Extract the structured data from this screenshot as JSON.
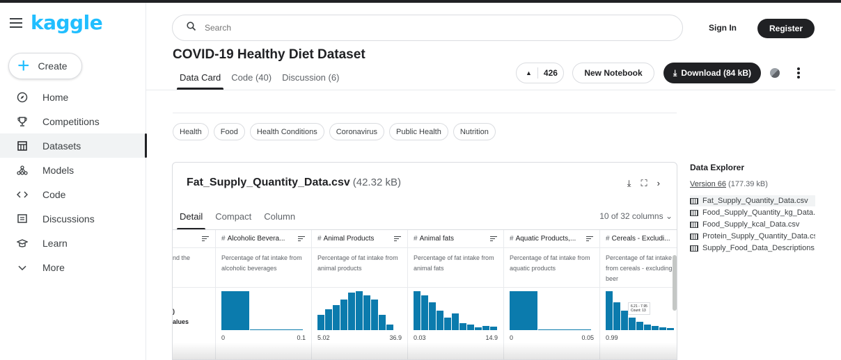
{
  "nav": {
    "logo": "kaggle",
    "create_label": "Create",
    "items": [
      {
        "label": "Home",
        "icon": "compass-icon"
      },
      {
        "label": "Competitions",
        "icon": "trophy-icon"
      },
      {
        "label": "Datasets",
        "icon": "table-icon",
        "active": true
      },
      {
        "label": "Models",
        "icon": "models-icon"
      },
      {
        "label": "Code",
        "icon": "code-icon"
      },
      {
        "label": "Discussions",
        "icon": "comment-icon"
      },
      {
        "label": "Learn",
        "icon": "graduation-cap-icon"
      },
      {
        "label": "More",
        "icon": "chevron-down-icon"
      }
    ]
  },
  "header": {
    "search_placeholder": "Search",
    "sign_in": "Sign In",
    "register": "Register"
  },
  "dataset": {
    "title": "COVID-19 Healthy Diet Dataset",
    "tabs": [
      "Data Card",
      "Code (40)",
      "Discussion (6)"
    ],
    "vote_count": "426",
    "new_notebook": "New Notebook",
    "download": "Download (84 kB)",
    "tags": [
      "Health",
      "Food",
      "Health Conditions",
      "Coronavirus",
      "Public Health",
      "Nutrition"
    ]
  },
  "file": {
    "name": "Fat_Supply_Quantity_Data.csv",
    "size": "(42.32 kB)",
    "subtabs": [
      "Detail",
      "Compact",
      "Column"
    ],
    "column_count": "10 of 32 columns",
    "first_col_desc": "nd the",
    "first_col_stat_1": ")",
    "first_col_stat_2": "alues",
    "columns": [
      {
        "name": "Alcoholic Bevera...",
        "desc": "Percentage of fat intake from alcoholic beverages",
        "min": "0",
        "max": "0.1"
      },
      {
        "name": "Animal Products",
        "desc": "Percentage of fat intake from animal products",
        "min": "5.02",
        "max": "36.9"
      },
      {
        "name": "Animal fats",
        "desc": "Percentage of fat intake from animal fats",
        "min": "0.03",
        "max": "14.9"
      },
      {
        "name": "Aquatic Products,...",
        "desc": "Percentage of fat intake from aquatic products",
        "min": "0",
        "max": "0.05"
      },
      {
        "name": "Cereals - Excludi...",
        "desc": "Percentage of fat intake from cereals - excluding beer",
        "min": "0.99",
        "max": ""
      }
    ],
    "tooltip_range": "6.21 - 7.95",
    "tooltip_count": "Count: 13"
  },
  "explorer": {
    "title": "Data Explorer",
    "version": "Version 66",
    "version_size": "(177.39 kB)",
    "files": [
      "Fat_Supply_Quantity_Data.csv",
      "Food_Supply_Quantity_kg_Data.csv",
      "Food_Supply_kcal_Data.csv",
      "Protein_Supply_Quantity_Data.csv",
      "Supply_Food_Data_Descriptions.csv"
    ]
  },
  "colors": {
    "brand": "#20beff",
    "histogram": "#0b7bad",
    "dark": "#202124"
  }
}
